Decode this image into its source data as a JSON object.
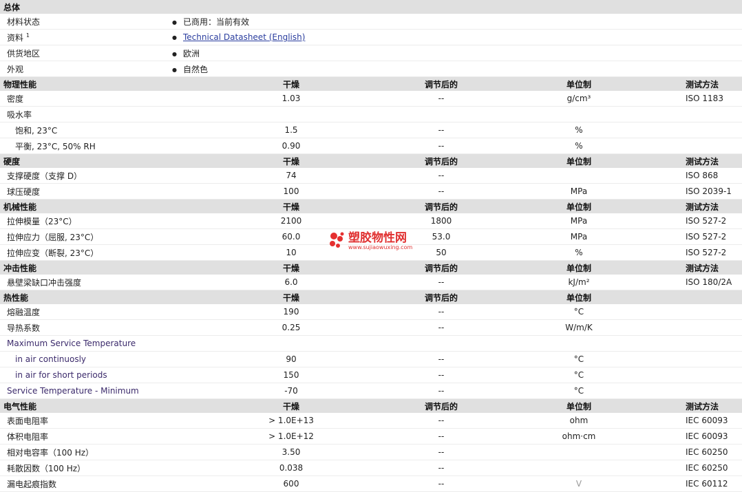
{
  "general": {
    "title": "总体",
    "rows": [
      {
        "label": "材料状态",
        "value": "已商用：当前有效",
        "link": false
      },
      {
        "label": "资料",
        "sup": "1",
        "value": "Technical Datasheet (English)",
        "link": true
      },
      {
        "label": "供货地区",
        "value": "欧洲",
        "link": false
      },
      {
        "label": "外观",
        "value": "自然色",
        "link": false
      }
    ]
  },
  "headers": {
    "dry": "干燥",
    "cond": "调节后的",
    "unit": "单位制",
    "method": "测试方法"
  },
  "sections": [
    {
      "title": "物理性能",
      "show_method": true,
      "rows": [
        {
          "label": "密度",
          "dry": "1.03",
          "cond": "--",
          "unit": "g/cm³",
          "method": "ISO 1183"
        },
        {
          "label": "吸水率",
          "dry": "",
          "cond": "",
          "unit": "",
          "method": ""
        },
        {
          "label": "饱和, 23°C",
          "sub": true,
          "dry": "1.5",
          "cond": "--",
          "unit": "%",
          "method": ""
        },
        {
          "label": "平衡, 23°C, 50% RH",
          "sub": true,
          "dry": "0.90",
          "cond": "--",
          "unit": "%",
          "method": ""
        }
      ]
    },
    {
      "title": "硬度",
      "show_method": true,
      "rows": [
        {
          "label": "支撑硬度（支撑 D）",
          "dry": "74",
          "cond": "--",
          "unit": "",
          "method": "ISO 868"
        },
        {
          "label": "球压硬度",
          "dry": "100",
          "cond": "--",
          "unit": "MPa",
          "method": "ISO 2039-1"
        }
      ]
    },
    {
      "title": "机械性能",
      "show_method": true,
      "rows": [
        {
          "label": "拉伸模量（23°C）",
          "dry": "2100",
          "cond": "1800",
          "unit": "MPa",
          "method": "ISO 527-2"
        },
        {
          "label": "拉伸应力（屈服, 23°C）",
          "dry": "60.0",
          "cond": "53.0",
          "unit": "MPa",
          "method": "ISO 527-2"
        },
        {
          "label": "拉伸应变（断裂, 23°C）",
          "dry": "10",
          "cond": "50",
          "unit": "%",
          "method": "ISO 527-2"
        }
      ]
    },
    {
      "title": "冲击性能",
      "show_method": true,
      "rows": [
        {
          "label": "悬壁梁缺口冲击强度",
          "dry": "6.0",
          "cond": "--",
          "unit": "kJ/m²",
          "method": "ISO 180/2A"
        }
      ]
    },
    {
      "title": "热性能",
      "show_method": false,
      "rows": [
        {
          "label": "熔融温度",
          "dry": "190",
          "cond": "--",
          "unit": "°C",
          "method": ""
        },
        {
          "label": "导热系数",
          "dry": "0.25",
          "cond": "--",
          "unit": "W/m/K",
          "method": ""
        },
        {
          "label": "Maximum Service Temperature",
          "purple": true,
          "dry": "",
          "cond": "",
          "unit": "",
          "method": ""
        },
        {
          "label": "in air continuosly",
          "sub": true,
          "purple": true,
          "dry": "90",
          "cond": "--",
          "unit": "°C",
          "method": ""
        },
        {
          "label": "in air for short periods",
          "sub": true,
          "purple": true,
          "dry": "150",
          "cond": "--",
          "unit": "°C",
          "method": ""
        },
        {
          "label": "Service Temperature - Minimum",
          "purple": true,
          "dry": "-70",
          "cond": "--",
          "unit": "°C",
          "method": ""
        }
      ]
    },
    {
      "title": "电气性能",
      "show_method": true,
      "rows": [
        {
          "label": "表面电阻率",
          "dry": "> 1.0E+13",
          "cond": "--",
          "unit": "ohm",
          "method": "IEC 60093"
        },
        {
          "label": "体积电阻率",
          "dry": "> 1.0E+12",
          "cond": "--",
          "unit": "ohm·cm",
          "method": "IEC 60093"
        },
        {
          "label": "相对电容率（100 Hz）",
          "dry": "3.50",
          "cond": "--",
          "unit": "",
          "method": "IEC 60250"
        },
        {
          "label": "耗散因数（100 Hz）",
          "dry": "0.038",
          "cond": "--",
          "unit": "",
          "method": "IEC 60250"
        },
        {
          "label": "漏电起痕指数",
          "dry": "600",
          "cond": "--",
          "unit": "V",
          "unit_dim": true,
          "method": "IEC 60112"
        }
      ]
    }
  ],
  "watermark": {
    "main": "塑胶物性网",
    "sub": "www.sujiaowuxing.com"
  }
}
